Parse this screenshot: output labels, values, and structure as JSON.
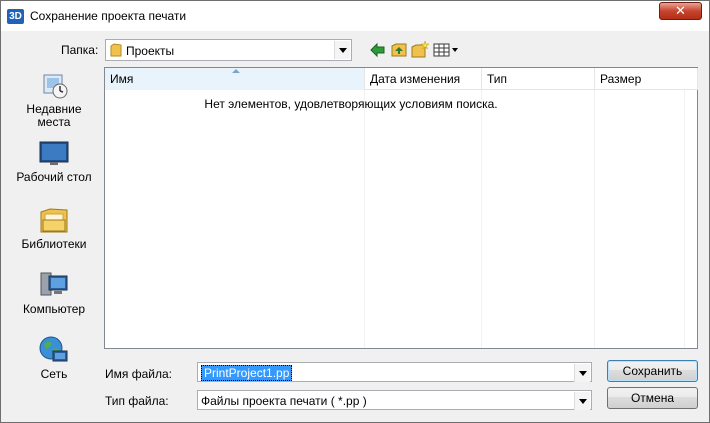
{
  "window": {
    "title": "Сохранение проекта печати",
    "app_icon_text": "3D",
    "close_glyph": "✕"
  },
  "location": {
    "label": "Папка:",
    "value": "Проекты"
  },
  "toolbar_icons": [
    "back-arrow-icon",
    "up-folder-icon",
    "new-folder-icon",
    "view-menu-icon"
  ],
  "places": [
    {
      "label": "Недавние места",
      "icon": "recent-places-icon"
    },
    {
      "label": "Рабочий стол",
      "icon": "desktop-icon"
    },
    {
      "label": "Библиотеки",
      "icon": "libraries-icon"
    },
    {
      "label": "Компьютер",
      "icon": "computer-icon"
    },
    {
      "label": "Сеть",
      "icon": "network-icon"
    }
  ],
  "list": {
    "columns": [
      "Имя",
      "Дата изменения",
      "Тип",
      "Размер"
    ],
    "empty_message": "Нет элементов, удовлетворяющих условиям поиска."
  },
  "filename": {
    "label": "Имя файла:",
    "value": "PrintProject1.pp"
  },
  "filetype": {
    "label": "Тип файла:",
    "value": "Файлы проекта печати ( *.pp )"
  },
  "buttons": {
    "save": "Сохранить",
    "cancel": "Отмена"
  },
  "colors": {
    "selection": "#3399ff",
    "close_button": "#c6452f",
    "folder": "#f1c14e"
  }
}
